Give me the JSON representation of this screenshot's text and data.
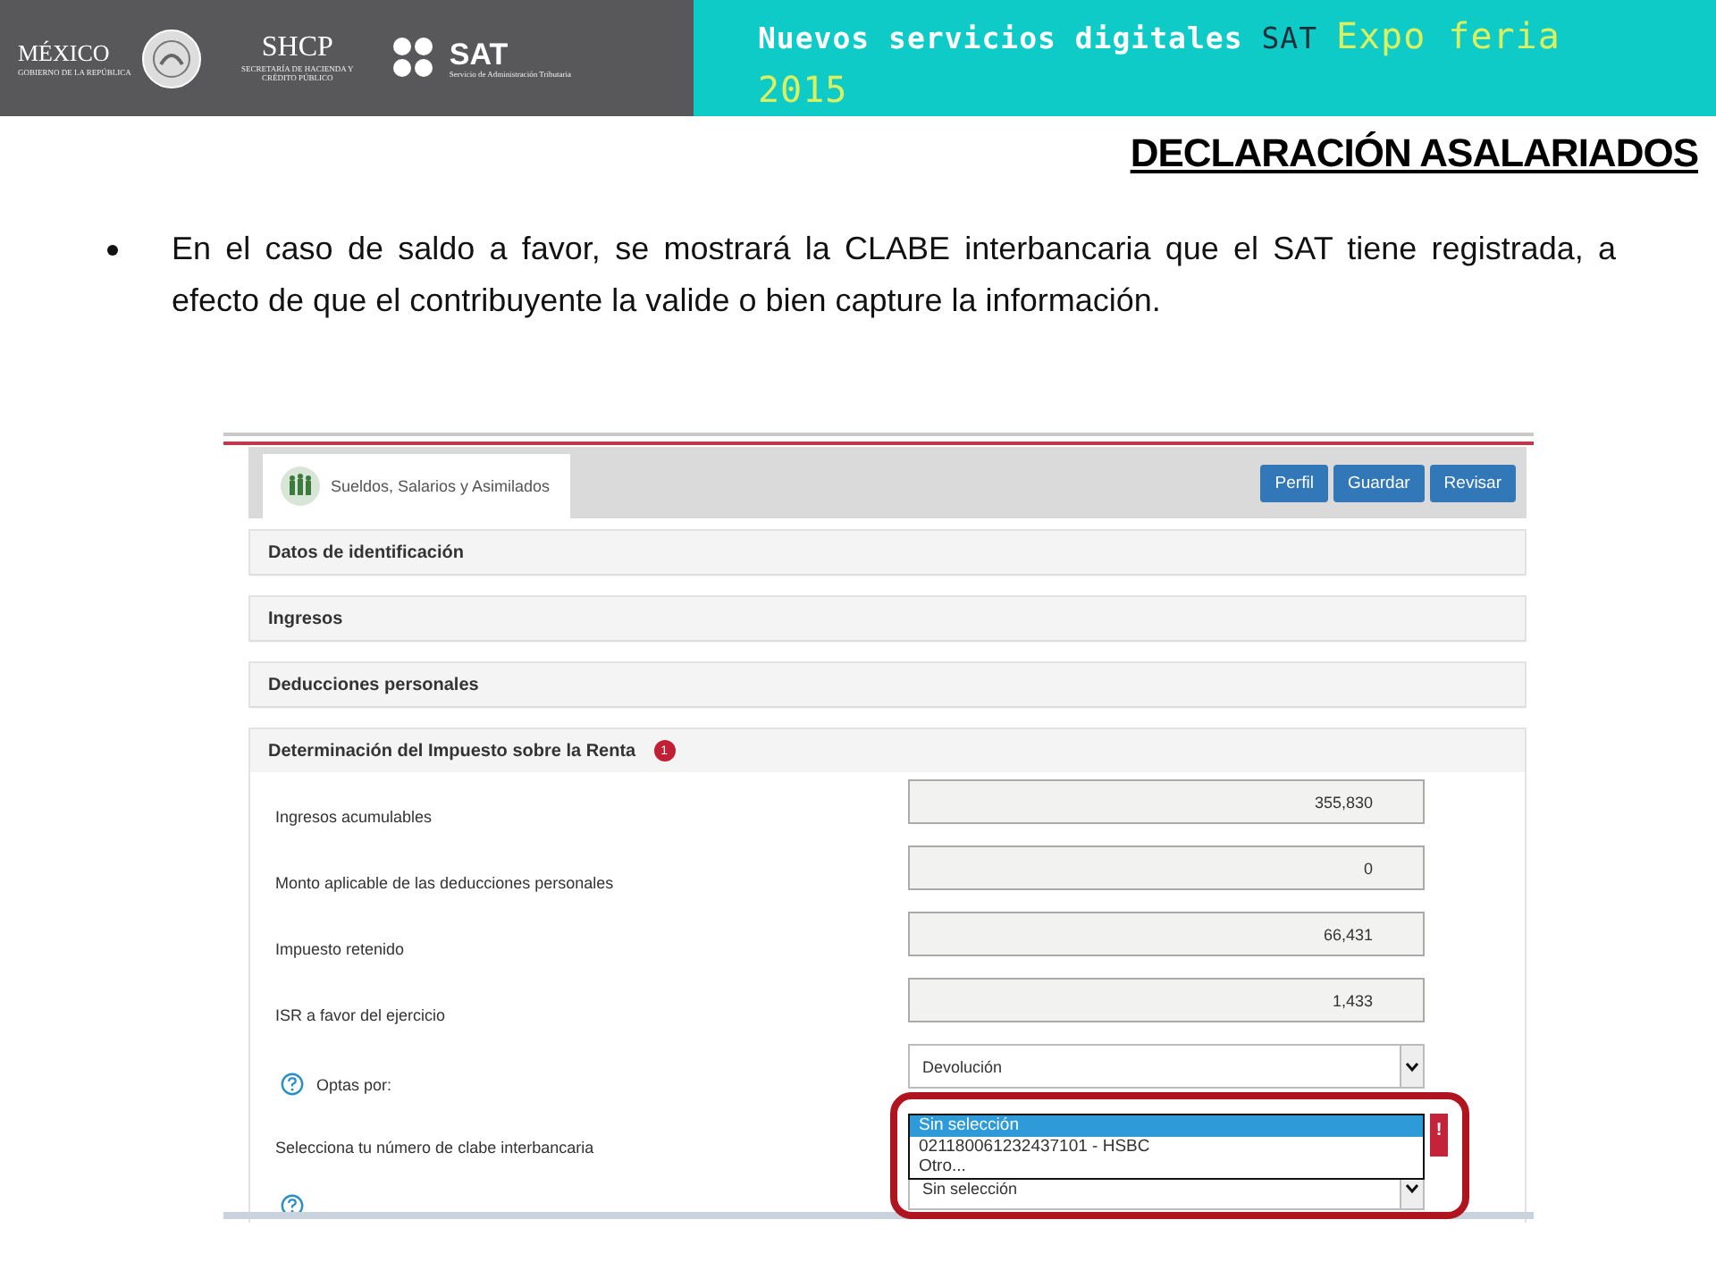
{
  "header": {
    "logos": [
      {
        "kind": "mexico",
        "name": "MÉXICO",
        "subtitle": "GOBIERNO DE LA REPÚBLICA"
      },
      {
        "kind": "shcp",
        "name": "SHCP",
        "subtitle": "SECRETARÍA DE HACIENDA Y CRÉDITO PÚBLICO"
      },
      {
        "kind": "sat",
        "name": "SAT",
        "subtitle": "Servicio de Administración Tributaria"
      }
    ],
    "banner": [
      {
        "kind": "plain",
        "text": "Nuevos servicios digitales"
      },
      {
        "kind": "brand",
        "text": "SAT"
      },
      {
        "kind": "accent",
        "text": "Expo feria 2015"
      }
    ]
  },
  "title": "DECLARACIÓN ASALARIADOS",
  "bullets": [
    "En el caso de saldo a favor, se mostrará la CLABE interbancaria que el SAT tiene registrada, a efecto de que el contribuyente la valide o bien capture la información."
  ],
  "app": {
    "module_title": "Sueldos, Salarios y Asimilados",
    "buttons": [
      "Perfil",
      "Guardar",
      "Revisar"
    ],
    "sections": [
      {
        "title": "Datos de identificación",
        "expanded": false
      },
      {
        "title": "Ingresos",
        "expanded": false
      },
      {
        "title": "Deducciones personales",
        "expanded": false
      },
      {
        "title": "Determinación del Impuesto sobre la Renta",
        "expanded": true,
        "badge": "1"
      }
    ],
    "fields": [
      {
        "kind": "amount",
        "label": "Ingresos acumulables",
        "value": "355,830"
      },
      {
        "kind": "amount",
        "label": "Monto aplicable de las deducciones personales",
        "value": "0"
      },
      {
        "kind": "amount",
        "label": "Impuesto retenido",
        "value": "66,431"
      },
      {
        "kind": "amount",
        "label": "ISR a favor del ejercicio",
        "value": "1,433"
      },
      {
        "kind": "select",
        "label": "Optas por:",
        "help": true,
        "value": "Devolución"
      },
      {
        "kind": "list",
        "label": "Selecciona tu número de clabe interbancaria",
        "error": "!",
        "options": [
          {
            "text": "Sin selección",
            "selected": true
          },
          {
            "text": "021180061232437101 - HSBC",
            "selected": false
          },
          {
            "text": "Otro...",
            "selected": false
          }
        ]
      },
      {
        "kind": "select",
        "help": true,
        "value": "Sin selección"
      }
    ]
  }
}
